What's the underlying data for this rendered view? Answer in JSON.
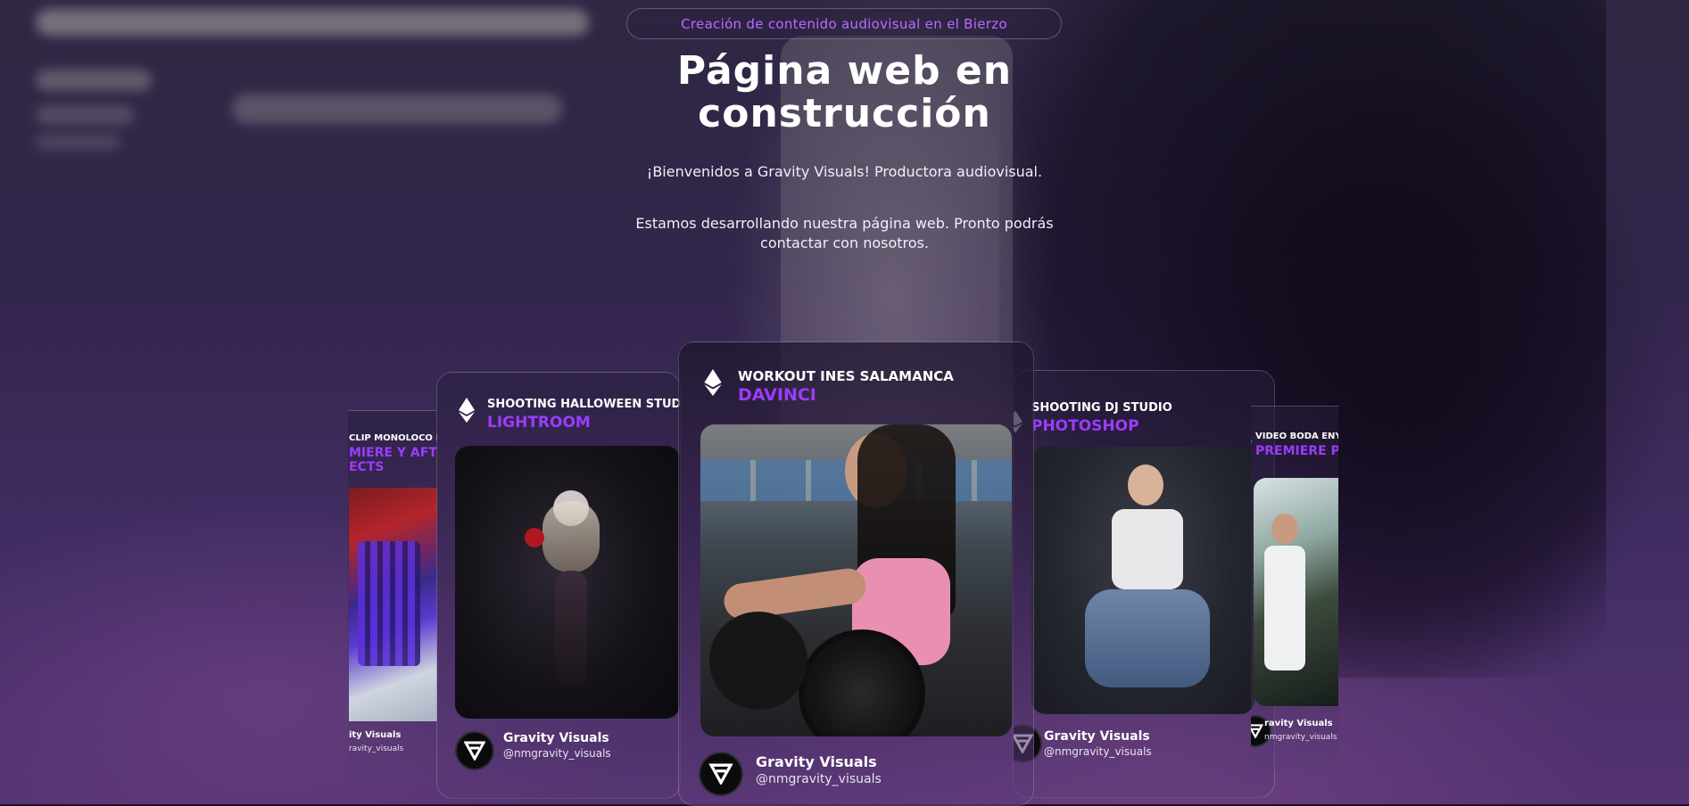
{
  "hero": {
    "badge": "Creación de contenido audiovisual en el Bierzo",
    "title_line1": "Página web en",
    "title_line2": "construcción",
    "welcome": "¡Bienvenidos a Gravity Visuals! Productora audiovisual.",
    "notice": "Estamos desarrollando nuestra página web. Pronto podrás contactar con nosotros."
  },
  "cards": [
    {
      "title": "CLIP MONOLOCO LEÓ",
      "tool_line1": "MIERE Y AFTER",
      "tool_line2": "ECTS",
      "name": "ity Visuals",
      "handle": "ravity_visuals",
      "photo_icon": "wristbands-photo-icon"
    },
    {
      "title": "SHOOTING HALLOWEEN STUDIO",
      "tool": "LIGHTROOM",
      "name": "Gravity Visuals",
      "handle": "@nmgravity_visuals",
      "photo_icon": "halloween-catrina-photo-icon"
    },
    {
      "title": "WORKOUT INES SALAMANCA",
      "tool": "DAVINCI",
      "name": "Gravity Visuals",
      "handle": "@nmgravity_visuals",
      "photo_icon": "woman-dumbbell-photo-icon"
    },
    {
      "title": "SHOOTING DJ STUDIO",
      "tool": "PHOTOSHOP",
      "name": "Gravity Visuals",
      "handle": "@nmgravity_visuals",
      "photo_icon": "dj-portrait-photo-icon"
    },
    {
      "title": "VIDEO BODA ENY J",
      "tool": "PREMIERE PR",
      "name": "ravity Visuals",
      "handle": "nmgravity_visuals",
      "photo_icon": "wedding-guests-photo-icon"
    }
  ],
  "colors": {
    "accent": "#9b3cff",
    "badge_text": "#b86bff",
    "text": "#ffffff"
  },
  "icons": [
    "ethereum-icon",
    "gravity-visuals-logo-icon"
  ]
}
